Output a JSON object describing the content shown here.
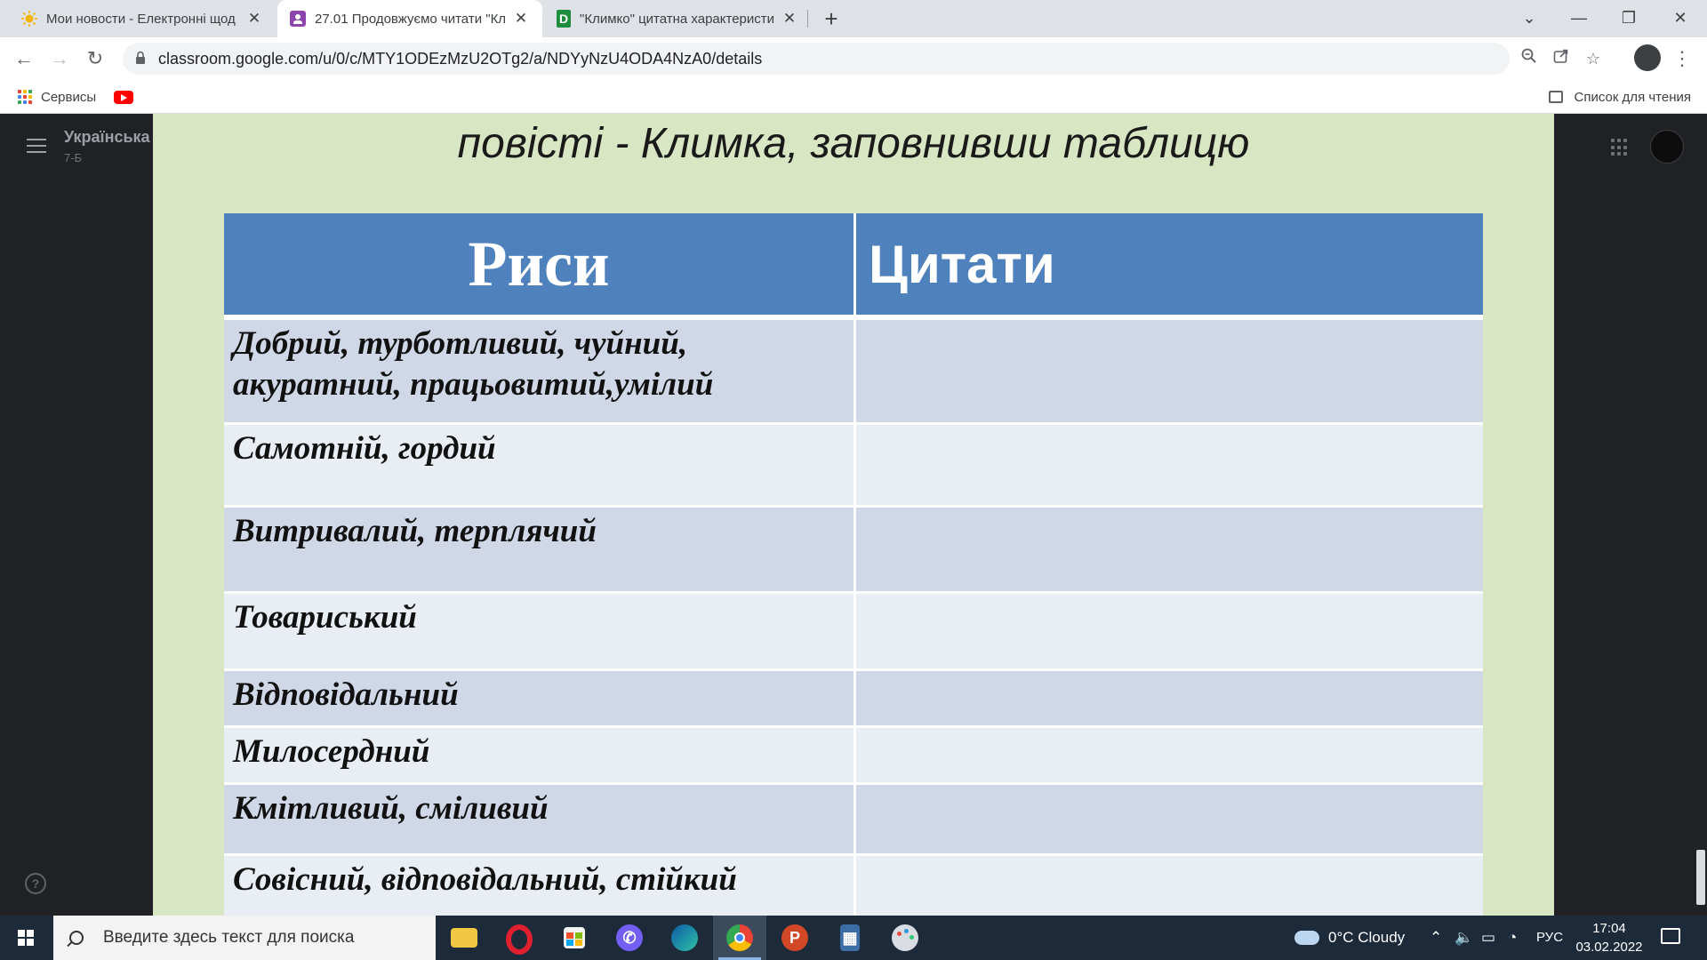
{
  "browser": {
    "tabs": [
      {
        "title": "Мои новости - Електронні щод",
        "icon": "sun-icon"
      },
      {
        "title": "27.01 Продовжуємо читати \"Кл",
        "icon": "classroom-icon"
      },
      {
        "title": "\"Климко\" цитатна характеристи",
        "icon": "docs-icon"
      }
    ],
    "new_tab": "+",
    "url": "classroom.google.com/u/0/c/MTY1ODEzMzU2OTg2/a/NDYyNzU4ODA4NzA0/details",
    "bookmarks": {
      "services": "Сервисы"
    },
    "reading_list": "Список для чтения"
  },
  "classroom": {
    "class_name": "Українська",
    "section": "7-Б"
  },
  "slide": {
    "heading": "повісті - Климка, заповнивши таблицю",
    "columns": [
      "Риси",
      "Цитати"
    ],
    "rows": [
      {
        "trait": "Добрий, турботливий, чуйний, акуратний,  працьовитий,умілий",
        "quote": ""
      },
      {
        "trait": "Самотній, гордий",
        "quote": ""
      },
      {
        "trait": "Витривалий, терплячий",
        "quote": ""
      },
      {
        "trait": "Товариський",
        "quote": ""
      },
      {
        "trait": "Відповідальний",
        "quote": ""
      },
      {
        "trait": "Милосердний",
        "quote": ""
      },
      {
        "trait": "Кмітливий, сміливий",
        "quote": ""
      },
      {
        "trait": "Совісний, відповідальний, стійкий",
        "quote": ""
      }
    ]
  },
  "taskbar": {
    "search_placeholder": "Введите здесь текст для поиска",
    "weather": "0°C  Cloudy",
    "language": "РУС",
    "time": "17:04",
    "date": "03.02.2022"
  },
  "colors": {
    "table_header": "#4f81bd",
    "row_dark": "#d0d8e8",
    "row_light": "#e9edf4",
    "slide_bg": "#d9e6c4"
  }
}
